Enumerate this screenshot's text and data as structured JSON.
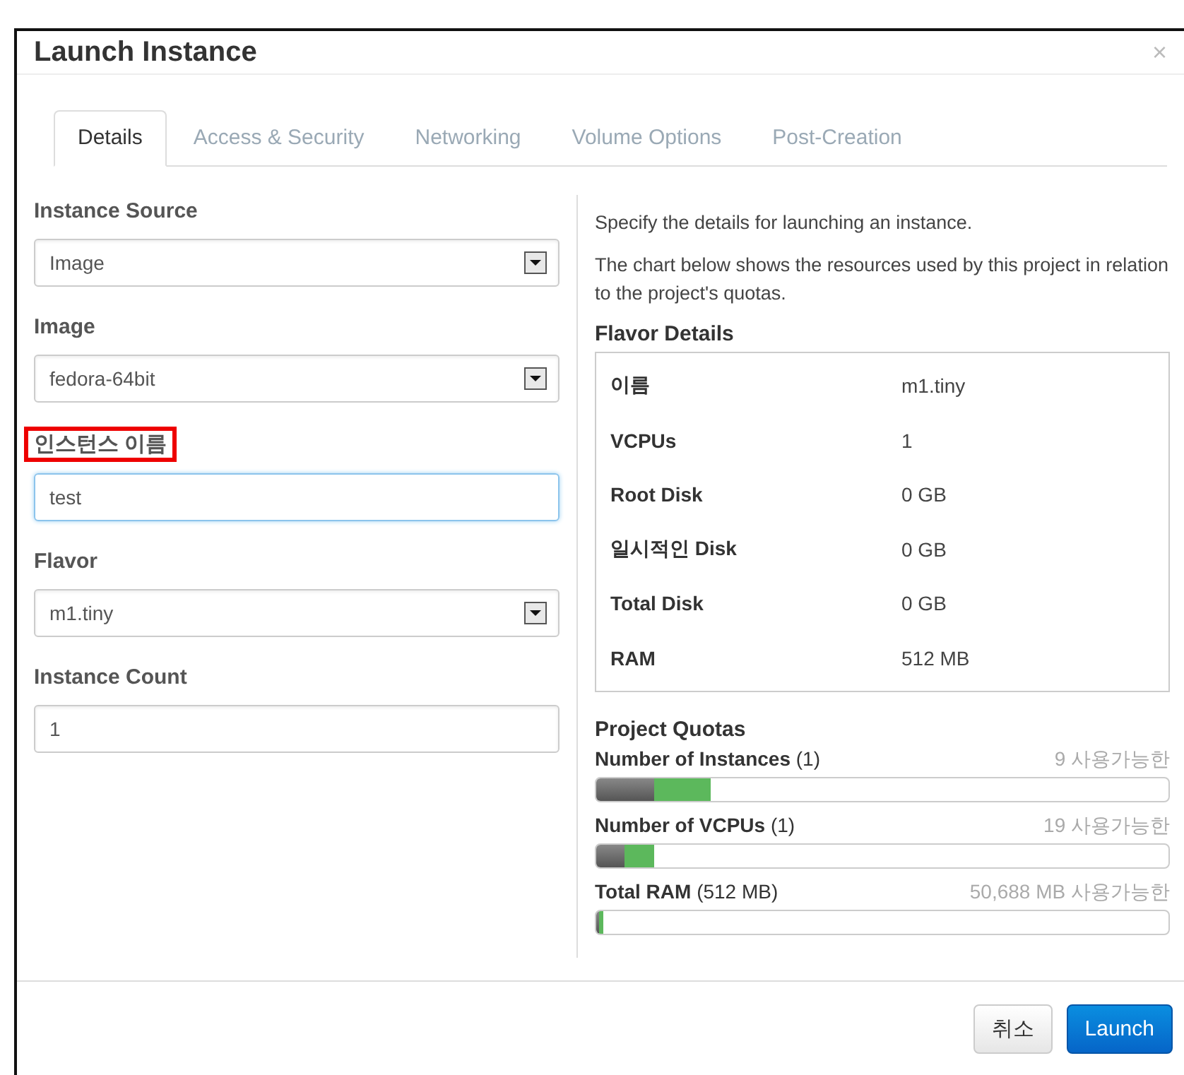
{
  "dialog": {
    "title": "Launch Instance",
    "close": "×"
  },
  "tabs": [
    {
      "label": "Details",
      "selected": true
    },
    {
      "label": "Access & Security",
      "selected": false
    },
    {
      "label": "Networking",
      "selected": false
    },
    {
      "label": "Volume Options",
      "selected": false
    },
    {
      "label": "Post-Creation",
      "selected": false
    }
  ],
  "fields": [
    {
      "kind": "select",
      "label": "Instance Source",
      "value": "Image",
      "highlighted": false,
      "focused": false
    },
    {
      "kind": "select",
      "label": "Image",
      "value": "fedora-64bit",
      "highlighted": false,
      "focused": false
    },
    {
      "kind": "text",
      "label": "인스턴스 이름",
      "value": "test",
      "highlighted": true,
      "focused": true
    },
    {
      "kind": "select",
      "label": "Flavor",
      "value": "m1.tiny",
      "highlighted": false,
      "focused": false
    },
    {
      "kind": "text",
      "label": "Instance Count",
      "value": "1",
      "highlighted": false,
      "focused": false
    }
  ],
  "description": [
    "Specify the details for launching an instance.",
    "The chart below shows the resources used by this project in relation to the project's quotas."
  ],
  "flavor_details": {
    "title": "Flavor Details",
    "rows": [
      {
        "name": "이름",
        "value": "m1.tiny"
      },
      {
        "name": "VCPUs",
        "value": "1"
      },
      {
        "name": "Root Disk",
        "value": "0 GB"
      },
      {
        "name": "일시적인 Disk",
        "value": "0 GB"
      },
      {
        "name": "Total Disk",
        "value": "0 GB"
      },
      {
        "name": "RAM",
        "value": "512 MB"
      }
    ]
  },
  "project_quotas": {
    "title": "Project Quotas",
    "items": [
      {
        "name": "Number of Instances",
        "amount": "(1)",
        "available": "9 사용가능한",
        "used": {
          "level": 0.1
        },
        "adding": {
          "level": 0.1
        }
      },
      {
        "name": "Number of VCPUs",
        "amount": "(1)",
        "available": "19 사용가능한",
        "used": {
          "level": 0.05
        },
        "adding": {
          "level": 0.05
        }
      },
      {
        "name": "Total RAM",
        "amount": "(512 MB)",
        "available": "50,688 MB 사용가능한",
        "used": {
          "level": 0.004
        },
        "adding": {
          "level": 0.008
        }
      }
    ]
  },
  "buttons": [
    {
      "label": "취소",
      "kind": "secondary"
    },
    {
      "label": "Launch",
      "kind": "primary"
    }
  ]
}
